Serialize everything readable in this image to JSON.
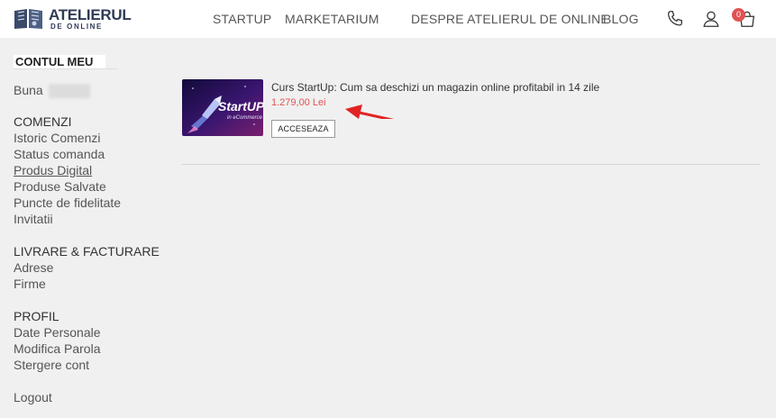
{
  "brand": {
    "name_top": "ATELIERUL",
    "name_bottom": "DE ONLINE"
  },
  "nav": {
    "items": [
      "STARTUP",
      "MARKETARIUM",
      "DESPRE ATELIERUL DE ONLINE",
      "BLOG"
    ]
  },
  "header_icons": [
    "phone-icon",
    "user-icon",
    "bag-icon"
  ],
  "cart": {
    "count": "0"
  },
  "sidebar": {
    "title": "CONTUL MEU",
    "greeting": "Buna",
    "sections": {
      "orders": {
        "heading": "COMENZI",
        "links": [
          "Istoric Comenzi",
          "Status comanda",
          "Produs Digital",
          "Produse Salvate",
          "Puncte de fidelitate",
          "Invitatii"
        ]
      },
      "delivery": {
        "heading": "LIVRARE & FACTURARE",
        "links": [
          "Adrese",
          "Firme"
        ]
      },
      "profile": {
        "heading": "PROFIL",
        "links": [
          "Date Personale",
          "Modifica Parola",
          "Stergere cont"
        ]
      }
    },
    "logout": "Logout"
  },
  "product": {
    "title": "Curs StartUp: Cum sa deschizi un magazin online profitabil in 14 zile",
    "price": "1.279,00 Lei",
    "button": "ACCESEAZA",
    "thumbnail_text": "StartUP",
    "thumbnail_subtext": "in eCommerce"
  },
  "colors": {
    "accent_red": "#e05252",
    "brand_navy": "#2f3b55",
    "background_grey": "#f0f0f0"
  }
}
